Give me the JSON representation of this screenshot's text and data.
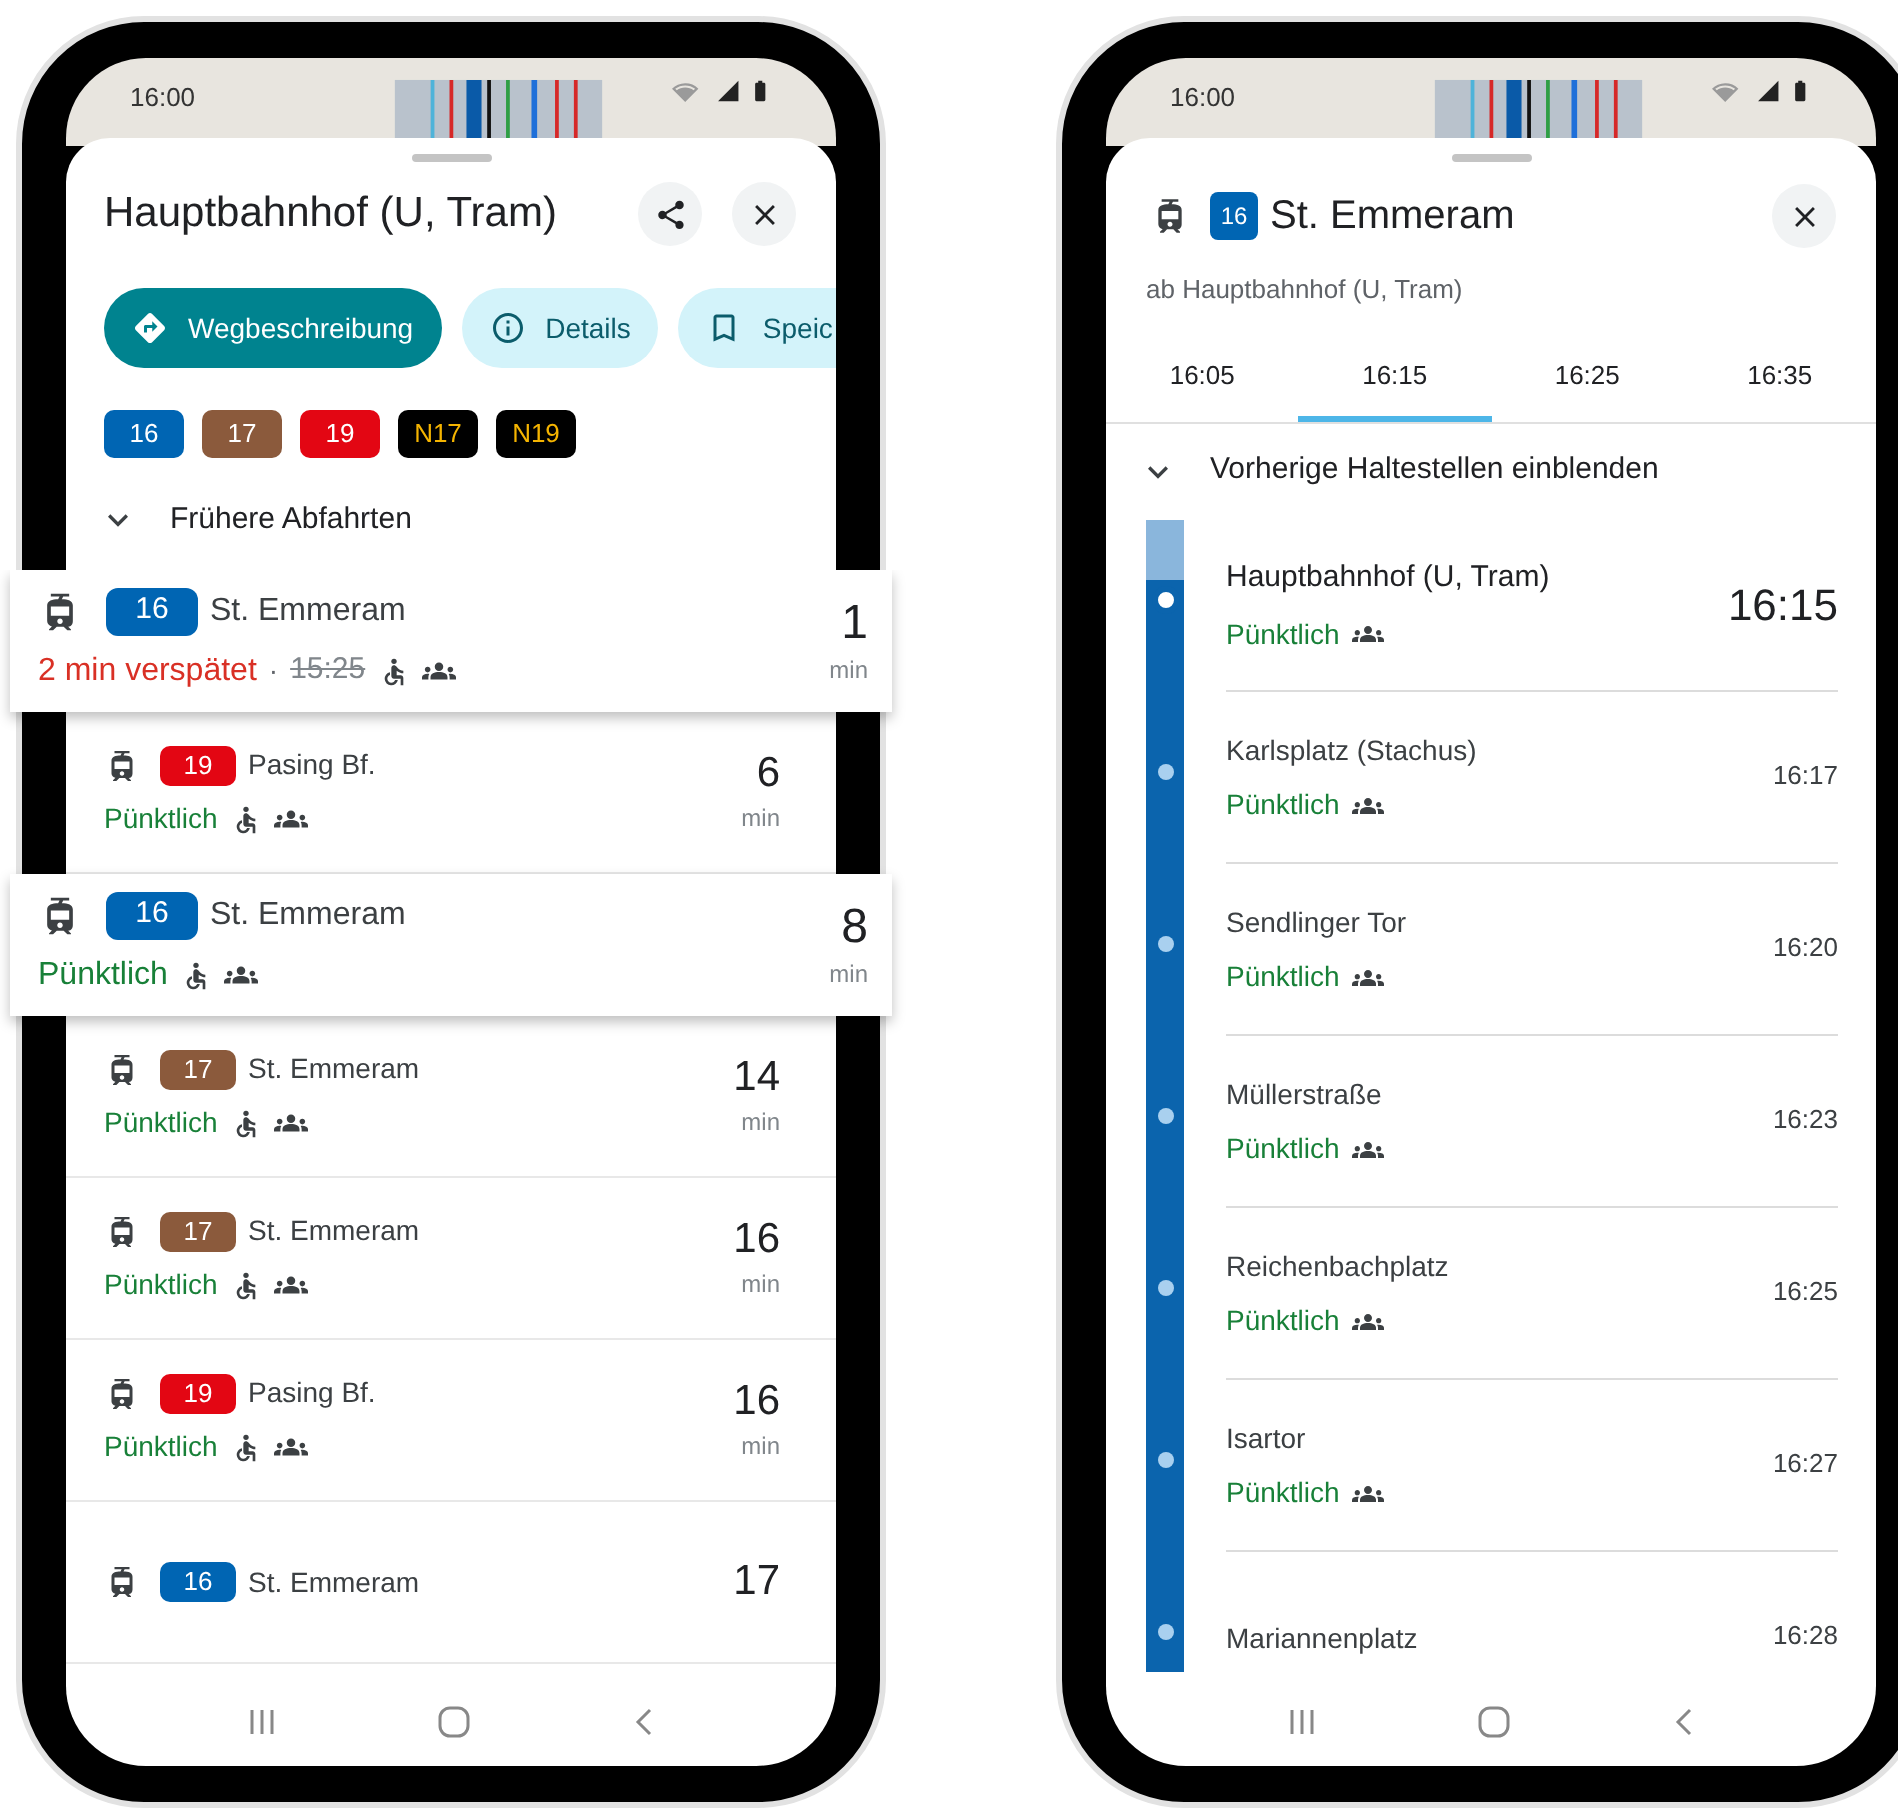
{
  "left_phone": {
    "status_time": "16:00",
    "title": "Hauptbahnhof (U, Tram)",
    "actions": [
      {
        "label": "Wegbeschreibung",
        "kind": "primary"
      },
      {
        "label": "Details",
        "kind": "secondary"
      },
      {
        "label": "Speic",
        "kind": "secondary"
      }
    ],
    "lines": [
      {
        "label": "16",
        "color": "#0065b3",
        "kind": "day"
      },
      {
        "label": "17",
        "color": "#8b5a3c",
        "kind": "day"
      },
      {
        "label": "19",
        "color": "#e30613",
        "kind": "day"
      },
      {
        "label": "N17",
        "color": "#000000",
        "kind": "night"
      },
      {
        "label": "N19",
        "color": "#000000",
        "kind": "night"
      }
    ],
    "earlier_toggle": "Frühere Abfahrten",
    "departures": [
      {
        "line": {
          "label": "16",
          "color": "#0065b3"
        },
        "destination": "St. Emmeram",
        "kind": "delayed",
        "status": "2 min verspätet",
        "separator": "·",
        "scheduled": "15:25",
        "minutes": "1",
        "unit": "min",
        "highlighted": true
      },
      {
        "line": {
          "label": "19",
          "color": "#e30613"
        },
        "destination": "Pasing Bf.",
        "kind": "on_time",
        "status": "Pünktlich",
        "minutes": "6",
        "unit": "min",
        "highlighted": false
      },
      {
        "line": {
          "label": "16",
          "color": "#0065b3"
        },
        "destination": "St. Emmeram",
        "kind": "on_time",
        "status": "Pünktlich",
        "minutes": "8",
        "unit": "min",
        "highlighted": true
      },
      {
        "line": {
          "label": "17",
          "color": "#8b5a3c"
        },
        "destination": "St. Emmeram",
        "kind": "on_time",
        "status": "Pünktlich",
        "minutes": "14",
        "unit": "min",
        "highlighted": false
      },
      {
        "line": {
          "label": "17",
          "color": "#8b5a3c"
        },
        "destination": "St. Emmeram",
        "kind": "on_time",
        "status": "Pünktlich",
        "minutes": "16",
        "unit": "min",
        "highlighted": false
      },
      {
        "line": {
          "label": "19",
          "color": "#e30613"
        },
        "destination": "Pasing Bf.",
        "kind": "on_time",
        "status": "Pünktlich",
        "minutes": "16",
        "unit": "min",
        "highlighted": false
      },
      {
        "line": {
          "label": "16",
          "color": "#0065b3"
        },
        "destination": "St. Emmeram",
        "minutes": "17",
        "highlighted": false
      }
    ]
  },
  "right_phone": {
    "status_time": "16:00",
    "line": {
      "label": "16",
      "color": "#0065b3"
    },
    "destination": "St. Emmeram",
    "subtitle": "ab Hauptbahnhof (U, Tram)",
    "tabs": [
      {
        "label": "16:05",
        "selected": false
      },
      {
        "label": "16:15",
        "selected": true
      },
      {
        "label": "16:25",
        "selected": false
      },
      {
        "label": "16:35",
        "selected": false
      }
    ],
    "previous_toggle": "Vorherige Haltestellen einblenden",
    "stops": [
      {
        "name": "Hauptbahnhof (U, Tram)",
        "status": "Pünktlich",
        "time": "16:15",
        "current": true
      },
      {
        "name": "Karlsplatz (Stachus)",
        "status": "Pünktlich",
        "time": "16:17",
        "current": false
      },
      {
        "name": "Sendlinger Tor",
        "status": "Pünktlich",
        "time": "16:20",
        "current": false
      },
      {
        "name": "Müllerstraße",
        "status": "Pünktlich",
        "time": "16:23",
        "current": false
      },
      {
        "name": "Reichenbachplatz",
        "status": "Pünktlich",
        "time": "16:25",
        "current": false
      },
      {
        "name": "Isartor",
        "status": "Pünktlich",
        "time": "16:27",
        "current": false
      },
      {
        "name": "Mariannenplatz",
        "time": "16:28",
        "current": false
      }
    ]
  }
}
